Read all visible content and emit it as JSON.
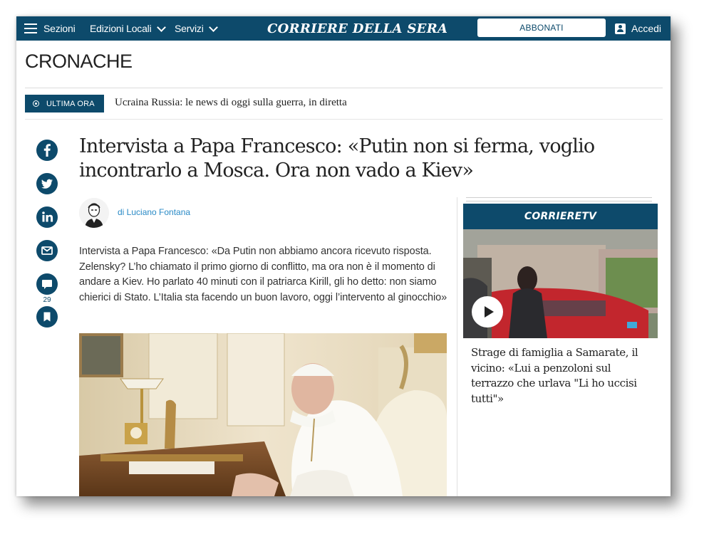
{
  "nav": {
    "sezioni": "Sezioni",
    "edizioni_locali": "Edizioni Locali",
    "servizi": "Servizi",
    "logo": "CORRIERE DELLA SERA",
    "abbonati": "ABBONATI",
    "accedi": "Accedi"
  },
  "section": {
    "title": "CRONACHE"
  },
  "breaking": {
    "label": "ULTIMA ORA",
    "text": "Ucraina Russia: le news di oggi sulla guerra, in diretta"
  },
  "share": {
    "icons": [
      "facebook-icon",
      "twitter-icon",
      "linkedin-icon",
      "email-icon",
      "comment-icon",
      "bookmark-icon"
    ],
    "comment_count": "29"
  },
  "article": {
    "headline": "Intervista a Papa Francesco: «Putin non si ferma, voglio incontrarlo a Mosca. Ora non vado a Kiev»",
    "author": "di Luciano Fontana",
    "summary": "Intervista a Papa Francesco: «Da Putin non abbiamo ancora ricevuto risposta. Zelensky? L’ho chiamato il primo giorno di conflitto, ma ora non è il momento di andare a Kiev. Ho parlato 40 minuti con il patriarca Kirill, gli ho detto: non siamo chierici di Stato. L’Italia sta facendo un buon lavoro, oggi l’intervento al ginocchio»"
  },
  "sidebar": {
    "tv_logo": "CORRIERETV",
    "video_caption": "Strage di famiglia a Samarate, il vicino: «Lui a penzoloni sul terrazzo che urlava \"Li ho uccisi tutti\"»"
  },
  "colors": {
    "brand": "#0d4a6b",
    "link": "#2a8ac6",
    "text": "#222222"
  }
}
